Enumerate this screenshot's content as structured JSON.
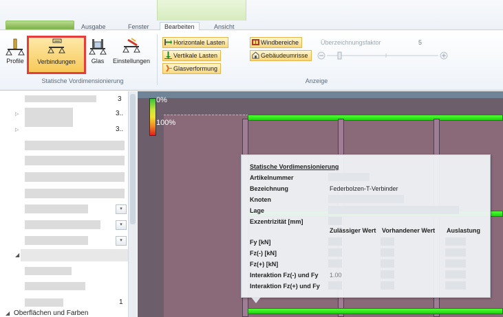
{
  "tabs": {
    "ausgabe": "Ausgabe",
    "fenster": "Fenster",
    "bearbeiten": "Bearbeiten",
    "ansicht": "Ansicht"
  },
  "ribbon": {
    "statische_group": {
      "label": "Statische Vordimensionierung",
      "profile": "Profile",
      "verbindungen": "Verbindungen",
      "glas": "Glas",
      "einstellungen": "Einstellungen"
    },
    "anzeige_group": {
      "label": "Anzeige",
      "horizontale_lasten": "Horizontale Lasten",
      "vertikale_lasten": "Vertikale Lasten",
      "glasverformung": "Glasverformung",
      "windbereiche": "Windbereiche",
      "gebaeudeumrisse": "Gebäudeumrisse",
      "ueberzeichnungsfaktor_label": "Überzeichnungsfaktor",
      "ueberzeichnungsfaktor_value": "5"
    }
  },
  "left_panel": {
    "values": [
      "3",
      "3..",
      "3..",
      "1"
    ],
    "bottom_item": "Oberflächen und Farben"
  },
  "canvas": {
    "scale_min": "0%",
    "scale_max": "100%"
  },
  "popup": {
    "title": "Statische Vordimensionierung",
    "artikelnummer_label": "Artikelnummer",
    "bezeichnung_label": "Bezeichnung",
    "bezeichnung_value": "Federbolzen-T-Verbinder",
    "knoten_label": "Knoten",
    "lage_label": "Lage",
    "exzentrizitaet_label": "Exzentrizität [mm]",
    "col_zulaessig": "Zulässiger Wert",
    "col_vorhanden": "Vorhandener Wert",
    "col_auslastung": "Auslastung",
    "rows": [
      "Fy [kN]",
      "Fz(-) [kN]",
      "Fz(+) [kN]",
      "Interaktion Fz(-) und Fy",
      "Interaktion Fz(+) und Fy"
    ],
    "interaktion_value": "1.00"
  },
  "colors": {
    "ribbon_highlight": "#f7c959",
    "selection_border": "#e53c3c",
    "beam_green": "#1fd30f",
    "canvas_bg": "#8a6a79"
  }
}
